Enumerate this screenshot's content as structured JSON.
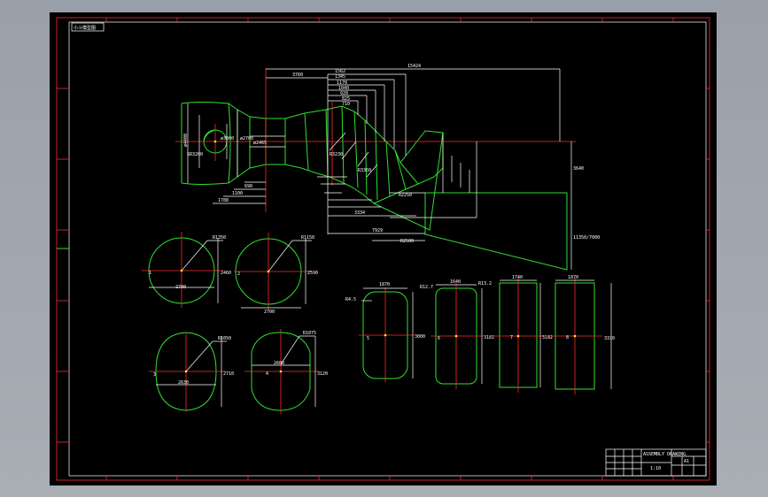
{
  "drawing": {
    "title_tag": "小斗模型图",
    "title_block": {
      "name": "ASSEMBLY DRAWING",
      "scale": "1:10",
      "sheet": "A1"
    }
  },
  "colors": {
    "background": "#000000",
    "outline": "#2fe02f",
    "dimension": "#ffffff",
    "centerline": "#ff2a2a",
    "frame_outer": "#ff2a2a",
    "point": "#ffee33"
  },
  "labels": {
    "d_top_long": "15424",
    "d_top_1": "3760",
    "d_top_2": "1562",
    "d_top_3": "1345",
    "d_top_4": "1170",
    "d_top_5": "1040",
    "d_top_6": "920",
    "d_top_7": "825",
    "d_top_8": "710",
    "d_left_1": "ø4400",
    "d_left_2": "SR3200",
    "d_left_3": "ø3000",
    "d_left_4": "ø2700",
    "d_left_5": "ø2465",
    "d_bottom_1": "1788",
    "d_bottom_2": "1100",
    "d_bottom_3": "690",
    "d_bottom_4": "3334",
    "d_bottom_5": "7929",
    "d_right_1": "3640",
    "d_right_2": "11350/7000",
    "d_mid_1": "R2250",
    "d_mid_2": "R2500",
    "d_mid_3": "R3230",
    "d_mid_4": "R3360",
    "sec_r1": "R1350",
    "sec_r2": "R1150",
    "sec_r3": "R1050",
    "sec_r4": "R1075",
    "sec_w1": "2700",
    "sec_w2": "2700",
    "sec_w3": "2630",
    "sec_w4": "2600",
    "sec_h1": "2460",
    "sec_h2": "2590",
    "sec_h3": "2710",
    "sec_h4": "3120",
    "sec_id1": "1",
    "sec_id2": "2",
    "sec_id3": "3",
    "sec_id4": "4",
    "rect_w1": "1870",
    "rect_w2": "1640",
    "rect_w3": "1740",
    "rect_w4": "1870",
    "rect_r1": "R4.5",
    "rect_r2": "R12.7",
    "rect_r3": "R13.2",
    "rect_h1": "3000",
    "rect_h2": "3181",
    "rect_h3": "3182",
    "rect_h4": "3310",
    "rect_id5": "5",
    "rect_id6": "6",
    "rect_id7": "7",
    "rect_id8": "8"
  }
}
